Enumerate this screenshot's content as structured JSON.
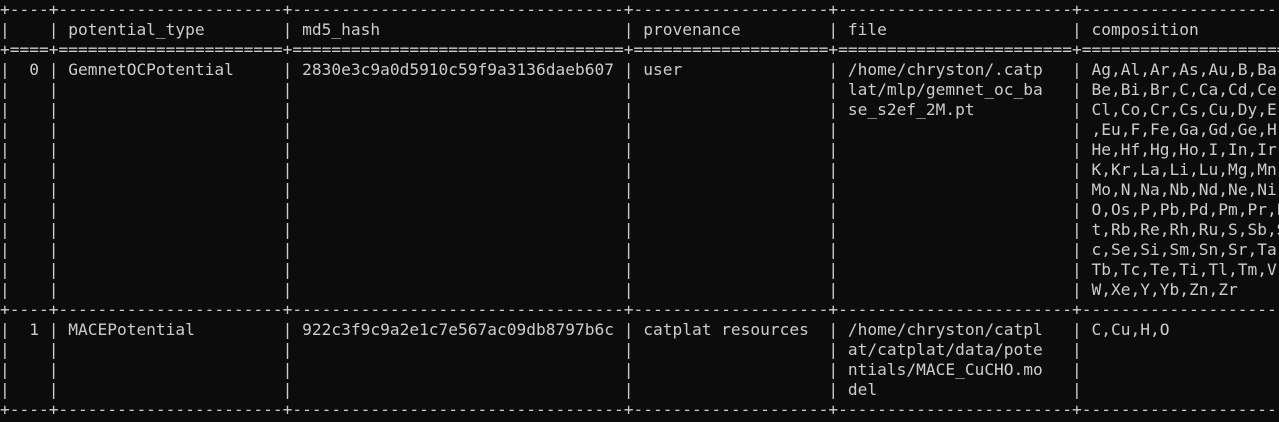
{
  "terminal": {
    "colors": {
      "background": "#0c0c0c",
      "foreground": "#cccccc"
    },
    "lines": [
      "+----+-----------------------+----------------------------------+--------------------+------------------------+--------------------------+",
      "|    | potential_type        | md5_hash                         | provenance         | file                   | composition              |",
      "+====+=======================+==================================+====================+========================+==========================+",
      "|  0 | GemnetOCPotential     | 2830e3c9a0d5910c59f9a3136daeb607 | user               | /home/chryston/.catp   | Ag,Al,Ar,As,Au,B,Ba,     |",
      "|    |                       |                                  |                    | lat/mlp/gemnet_oc_ba   | Be,Bi,Br,C,Ca,Cd,Ce,     |",
      "|    |                       |                                  |                    | se_s2ef_2M.pt          | Cl,Co,Cr,Cs,Cu,Dy,Er     |",
      "|    |                       |                                  |                    |                        | ,Eu,F,Fe,Ga,Gd,Ge,H,     |",
      "|    |                       |                                  |                    |                        | He,Hf,Hg,Ho,I,In,Ir,     |",
      "|    |                       |                                  |                    |                        | K,Kr,La,Li,Lu,Mg,Mn,     |",
      "|    |                       |                                  |                    |                        | Mo,N,Na,Nb,Nd,Ne,Ni,     |",
      "|    |                       |                                  |                    |                        | O,Os,P,Pb,Pd,Pm,Pr,P     |",
      "|    |                       |                                  |                    |                        | t,Rb,Re,Rh,Ru,S,Sb,S     |",
      "|    |                       |                                  |                    |                        | c,Se,Si,Sm,Sn,Sr,Ta,     |",
      "|    |                       |                                  |                    |                        | Tb,Tc,Te,Ti,Tl,Tm,V,     |",
      "|    |                       |                                  |                    |                        | W,Xe,Y,Yb,Zn,Zr          |",
      "+----+-----------------------+----------------------------------+--------------------+------------------------+--------------------------+",
      "|  1 | MACEPotential         | 922c3f9c9a2e1c7e567ac09db8797b6c | catplat resources  | /home/chryston/catpl   | C,Cu,H,O                 |",
      "|    |                       |                                  |                    | at/catplat/data/pote   |                          |",
      "|    |                       |                                  |                    | ntials/MACE_CuCHO.mo   |                          |",
      "|    |                       |                                  |                    | del                    |                          |",
      "+----+-----------------------+----------------------------------+--------------------+------------------------+--------------------------+"
    ]
  }
}
